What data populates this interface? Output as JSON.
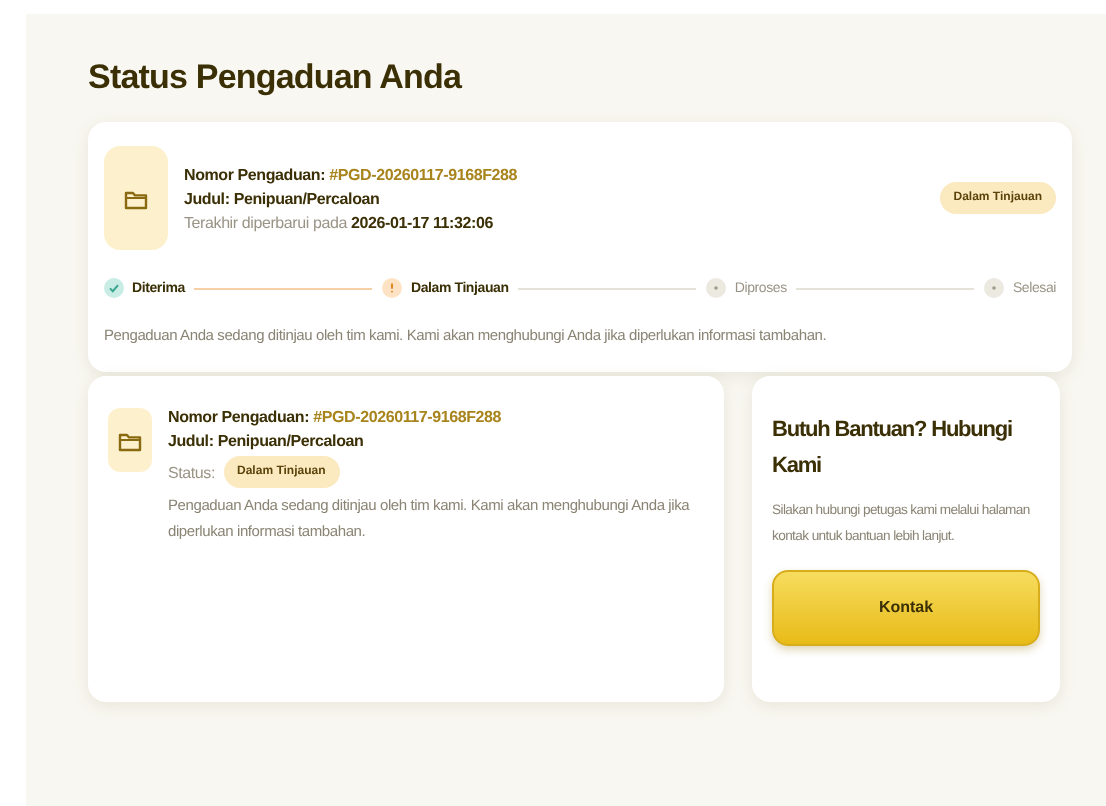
{
  "title": "Status Pengaduan Anda",
  "summary": {
    "number_label": "Nomor Pengaduan:",
    "number": "#PGD-20260117-9168F288",
    "subject": "Judul: Penipuan/Percaloan",
    "updated_label": "Terakhir diperbarui pada",
    "updated": "2026-01-17 11:32:06",
    "badge": "Dalam Tinjauan",
    "steps": [
      {
        "label": "Diterima",
        "kind": "done"
      },
      {
        "label": "Dalam Tinjauan",
        "kind": "current"
      },
      {
        "label": "Diproses",
        "kind": "pending"
      },
      {
        "label": "Selesai",
        "kind": "pending"
      }
    ],
    "message": "Pengaduan Anda sedang ditinjau oleh tim kami. Kami akan menghubungi Anda jika diperlukan informasi tambahan."
  },
  "detail": {
    "number_label": "Nomor Pengaduan:",
    "number": "#PGD-20260117-9168F288",
    "subject": "Judul: Penipuan/Percaloan",
    "status_label": "Status:",
    "badge": "Dalam Tinjauan",
    "message": "Pengaduan Anda sedang ditinjau oleh tim kami. Kami akan menghubungi Anda jika diperlukan informasi tambahan."
  },
  "help": {
    "title": "Butuh Bantuan? Hubungi Kami",
    "text": "Silakan hubungi petugas kami melalui halaman kontak untuk bantuan lebih lanjut.",
    "button": "Kontak"
  }
}
